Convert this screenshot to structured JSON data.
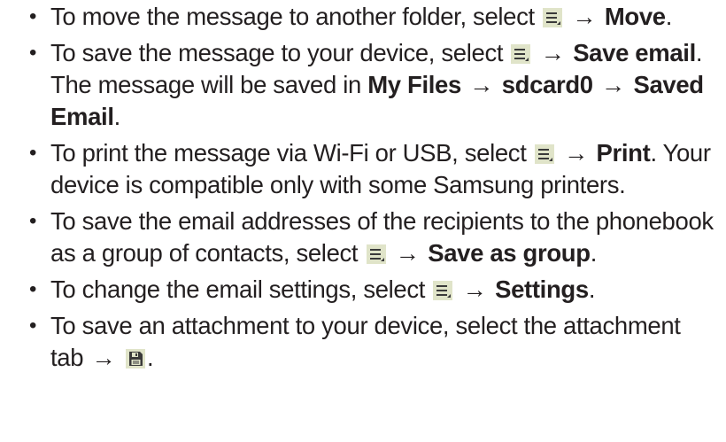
{
  "items": [
    {
      "s1": "To move the message to another folder, select",
      "s2": "→",
      "b1": "Move",
      "s3": "."
    },
    {
      "s1": "To save the message to your device, select",
      "s2": "→",
      "b1": "Save email",
      "s3": ". The message will be saved in",
      "b2": "My Files",
      "s4": "→",
      "b3": "sdcard0",
      "s5": "→",
      "b4": "Saved Email",
      "s6": "."
    },
    {
      "s1": "To print the message via Wi-Fi or USB, select",
      "s2": "→",
      "b1": "Print",
      "s3": ". Your device is compatible only with some Samsung printers."
    },
    {
      "s1": "To save the email addresses of the recipients to the phonebook as a group of contacts, select",
      "s2": "→",
      "b1": "Save as group",
      "s3": "."
    },
    {
      "s1": "To change the email settings, select",
      "s2": "→",
      "b1": "Settings",
      "s3": "."
    },
    {
      "s1": "To save an attachment to your device, select the attachment tab",
      "s2": "→",
      "s3": "."
    }
  ],
  "bullet_glyph": "•",
  "icons": {
    "menu": "menu-icon",
    "save": "save-disk-icon"
  },
  "colors": {
    "text": "#231f20",
    "icon_bg": "#e0e4c9",
    "icon_fg": "#3a3a3a"
  }
}
